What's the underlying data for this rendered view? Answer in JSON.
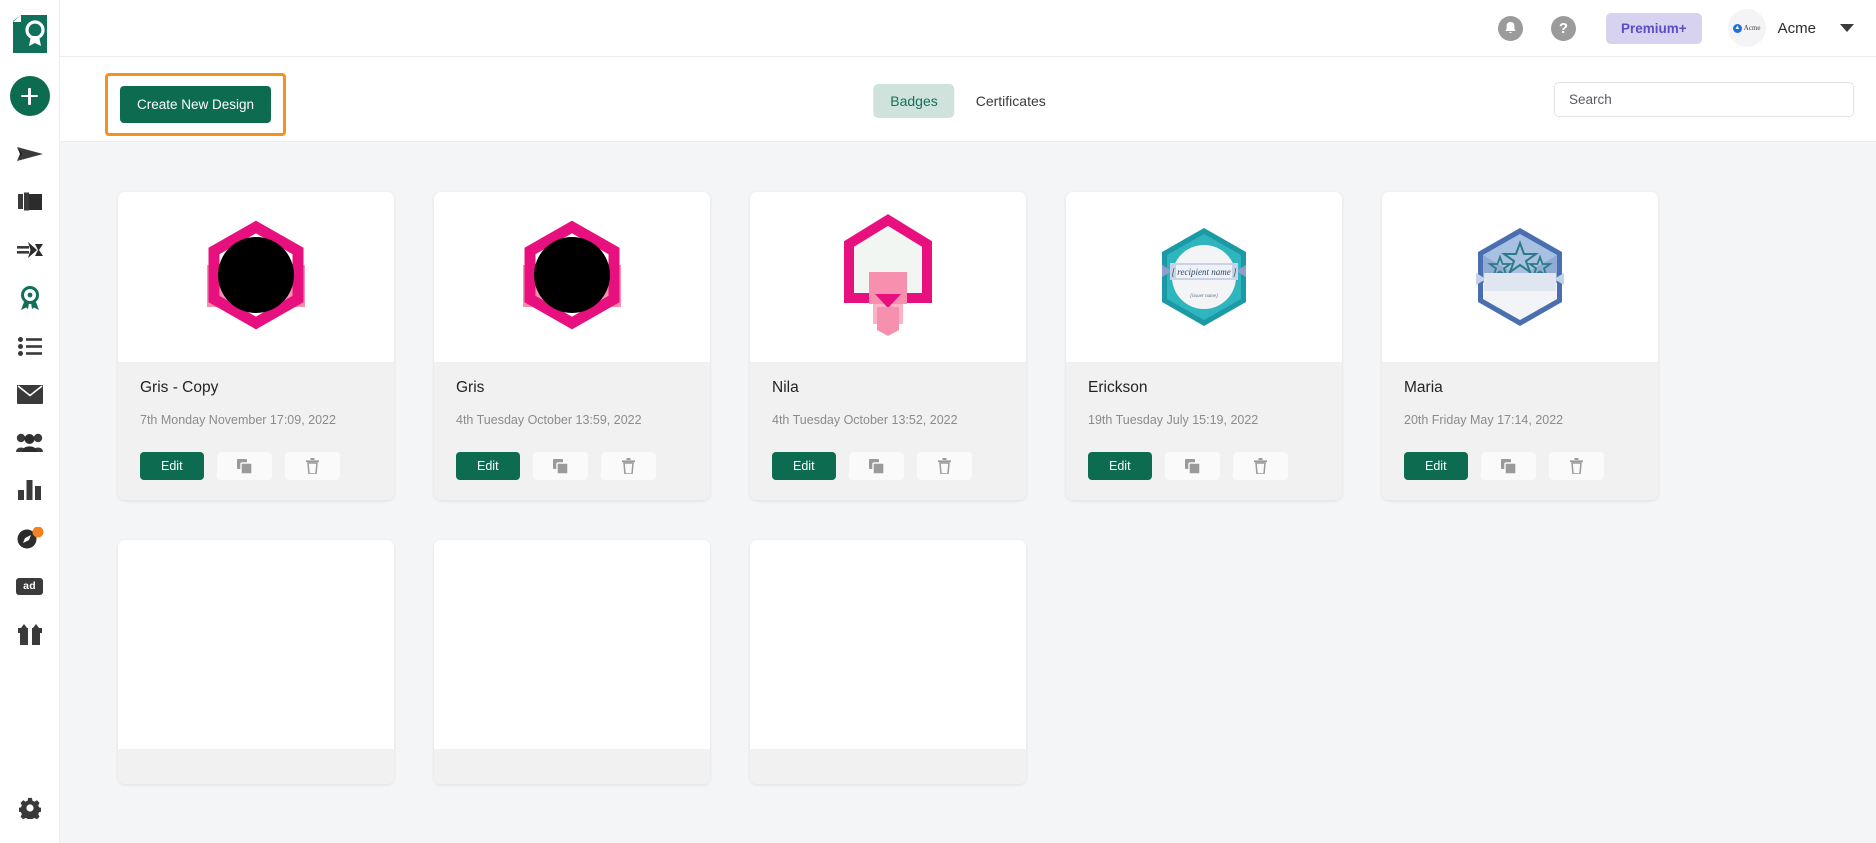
{
  "sidebar": {
    "logo_name": "app-logo-certificate",
    "add_button_label": "+",
    "items": [
      {
        "name": "send-icon",
        "label": "Send"
      },
      {
        "name": "collection-icon",
        "label": "Collections"
      },
      {
        "name": "integrations-icon",
        "label": "Integrations"
      },
      {
        "name": "badge-icon",
        "label": "Badges"
      },
      {
        "name": "list-icon",
        "label": "Lists"
      },
      {
        "name": "mail-icon",
        "label": "Mail"
      },
      {
        "name": "people-icon",
        "label": "Recipients"
      },
      {
        "name": "analytics-icon",
        "label": "Analytics"
      },
      {
        "name": "compass-icon",
        "label": "Discover"
      },
      {
        "name": "ad-icon",
        "label": "ad"
      },
      {
        "name": "gift-icon",
        "label": "Gifts"
      }
    ],
    "bottom": {
      "name": "gear-icon",
      "label": "Settings"
    }
  },
  "header": {
    "notification_icon": "bell-icon",
    "help_icon": "question-mark-icon",
    "premium_label": "Premium+",
    "org_avatar_label": "Acme",
    "org_name": "Acme",
    "caret_icon": "chevron-down-icon"
  },
  "toolbar": {
    "create_label": "Create New Design",
    "tabs": [
      {
        "label": "Badges",
        "active": true
      },
      {
        "label": "Certificates",
        "active": false
      }
    ],
    "search": {
      "value": "",
      "placeholder": "Search"
    }
  },
  "accent_colors": {
    "primary_green": "#0d6b50",
    "highlight_orange": "#f5921e",
    "tab_active_bg": "#cfe3dc",
    "premium_bg": "#d6d2f0",
    "premium_text": "#5b4ec4",
    "badge_pink": "#e8107f",
    "badge_pink_light": "#f78fae",
    "badge_teal": "#1b9aa6",
    "badge_blue": "#4a6fb0"
  },
  "cards": [
    {
      "title": "Gris - Copy",
      "date": "7th Monday November 17:09, 2022",
      "badge": "pink-hex-avatar",
      "edit_label": "Edit",
      "duplicate_icon": "copy-icon",
      "delete_icon": "trash-icon"
    },
    {
      "title": "Gris",
      "date": "4th Tuesday October 13:59, 2022",
      "badge": "pink-hex-avatar",
      "edit_label": "Edit",
      "duplicate_icon": "copy-icon",
      "delete_icon": "trash-icon"
    },
    {
      "title": "Nila",
      "date": "4th Tuesday October 13:52, 2022",
      "badge": "pink-hex-ribbon",
      "edit_label": "Edit",
      "duplicate_icon": "copy-icon",
      "delete_icon": "trash-icon"
    },
    {
      "title": "Erickson",
      "date": "19th Tuesday July 15:19, 2022",
      "badge": "teal-hex-recipient",
      "badge_text_primary": "[ recipient name ]",
      "badge_text_secondary": "[issuer name]",
      "edit_label": "Edit",
      "duplicate_icon": "copy-icon",
      "delete_icon": "trash-icon"
    },
    {
      "title": "Maria",
      "date": "20th Friday May 17:14, 2022",
      "badge": "blue-hex-stars",
      "edit_label": "Edit",
      "duplicate_icon": "copy-icon",
      "delete_icon": "trash-icon"
    }
  ],
  "placeholder_cards": 3
}
